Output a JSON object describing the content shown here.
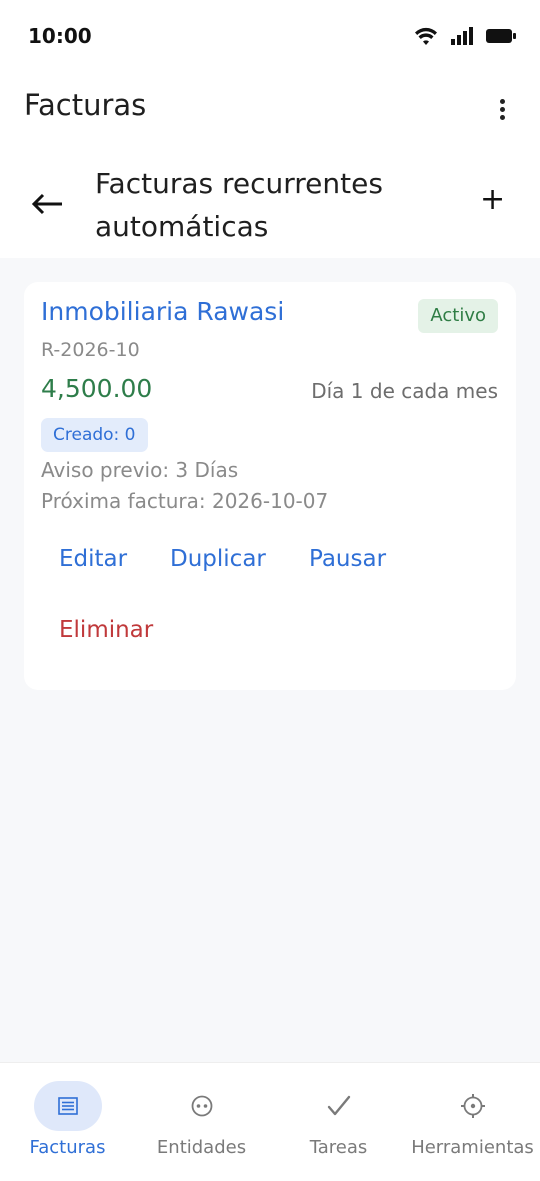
{
  "status_bar": {
    "time": "10:00",
    "icons": [
      "wifi-icon",
      "signal-icon",
      "battery-icon"
    ]
  },
  "app_bar": {
    "title": "Facturas",
    "menu_icon": "more-vert-icon"
  },
  "sub_header": {
    "back_icon": "arrow-left-icon",
    "title": "Facturas recurrentes automáticas",
    "add_label": "+"
  },
  "card": {
    "client_name": "Inmobiliaria Rawasi",
    "status": "Activo",
    "code": "R-2026-10",
    "amount": "4,500.00",
    "frequency": "Día 1 de cada mes",
    "created": "Creado: 0",
    "notice": "Aviso previo: 3 Días",
    "next_invoice": "Próxima factura: 2026-10-07",
    "actions": {
      "edit": "Editar",
      "duplicate": "Duplicar",
      "pause": "Pausar",
      "delete": "Eliminar"
    }
  },
  "bottom_nav": {
    "items": [
      {
        "label": "Facturas",
        "icon": "list-icon",
        "active": true
      },
      {
        "label": "Entidades",
        "icon": "entity-icon",
        "active": false
      },
      {
        "label": "Tareas",
        "icon": "check-icon",
        "active": false
      },
      {
        "label": "Herramientas",
        "icon": "gear-icon",
        "active": false
      }
    ]
  },
  "colors": {
    "accent": "#2f6fd6",
    "success": "#2e7d4a",
    "danger": "#c0393b",
    "background": "#f7f8fa"
  }
}
